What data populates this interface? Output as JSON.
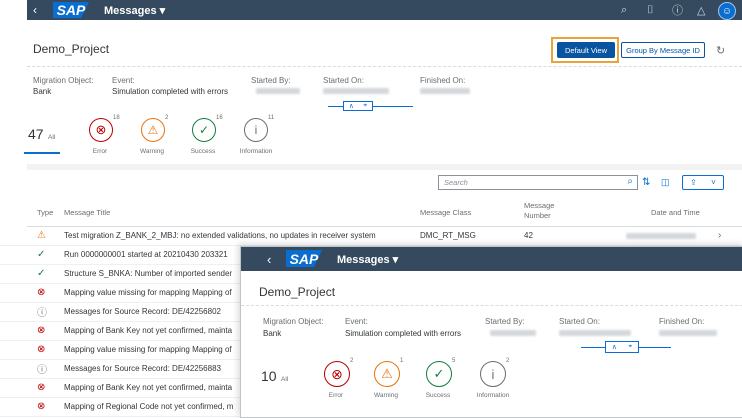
{
  "shell": {
    "back_icon": "back-arrow-icon",
    "logo": "SAP",
    "title": "Messages ▾"
  },
  "page": {
    "title": "Demo_Project"
  },
  "toolbar": {
    "default_view": "Default View",
    "group_by": "Group By Message ID"
  },
  "header": {
    "migration_object_label": "Migration Object:",
    "migration_object_value": "Bank",
    "event_label": "Event:",
    "event_value": "Simulation completed with errors",
    "started_by_label": "Started By:",
    "started_on_label": "Started On:",
    "finished_on_label": "Finished On:"
  },
  "filters": {
    "total_count": "47",
    "total_label": "All",
    "items": [
      {
        "label": "Error",
        "count": "18",
        "icon": "error-icon",
        "color": "#bb0000"
      },
      {
        "label": "Warning",
        "count": "2",
        "icon": "warning-icon",
        "color": "#e9730c"
      },
      {
        "label": "Success",
        "count": "16",
        "icon": "success-icon",
        "color": "#107e3e"
      },
      {
        "label": "Information",
        "count": "11",
        "icon": "information-icon",
        "color": "#6a6d70"
      }
    ]
  },
  "table": {
    "search_placeholder": "Search",
    "headers": {
      "type": "Type",
      "title": "Message Title",
      "class": "Message Class",
      "number": "Message Number",
      "date": "Date and Time"
    },
    "rows": [
      {
        "type": "warning",
        "title": "Test migration Z_BANK_2_MBJ: no extended validations, no updates in receiver system",
        "class": "DMC_RT_MSG",
        "number": "42"
      },
      {
        "type": "success",
        "title": "Run 0000000001 started at 20210430 203321"
      },
      {
        "type": "success",
        "title": "Structure S_BNKA: Number of imported sender"
      },
      {
        "type": "error",
        "title": "Mapping value missing for mapping Mapping of"
      },
      {
        "type": "info",
        "title": "Messages for Source Record: DE/42256802"
      },
      {
        "type": "error",
        "title": "Mapping of Bank Key not yet confirmed, mainta"
      },
      {
        "type": "error",
        "title": "Mapping value missing for mapping Mapping of"
      },
      {
        "type": "info",
        "title": "Messages for Source Record: DE/42256883"
      },
      {
        "type": "error",
        "title": "Mapping of Bank Key not yet confirmed, mainta"
      },
      {
        "type": "error",
        "title": "Mapping of Regional Code not yet confirmed, m"
      }
    ]
  },
  "overlay": {
    "shell_title": "Messages ▾",
    "logo": "SAP",
    "page_title": "Demo_Project",
    "migration_object_label": "Migration Object:",
    "migration_object_value": "Bank",
    "event_label": "Event:",
    "event_value": "Simulation completed with errors",
    "started_by_label": "Started By:",
    "started_on_label": "Started On:",
    "finished_on_label": "Finished On:",
    "total_count": "10",
    "total_label": "All",
    "items": [
      {
        "label": "Error",
        "count": "2"
      },
      {
        "label": "Warning",
        "count": "1"
      },
      {
        "label": "Success",
        "count": "5"
      },
      {
        "label": "Information",
        "count": "2"
      }
    ]
  }
}
